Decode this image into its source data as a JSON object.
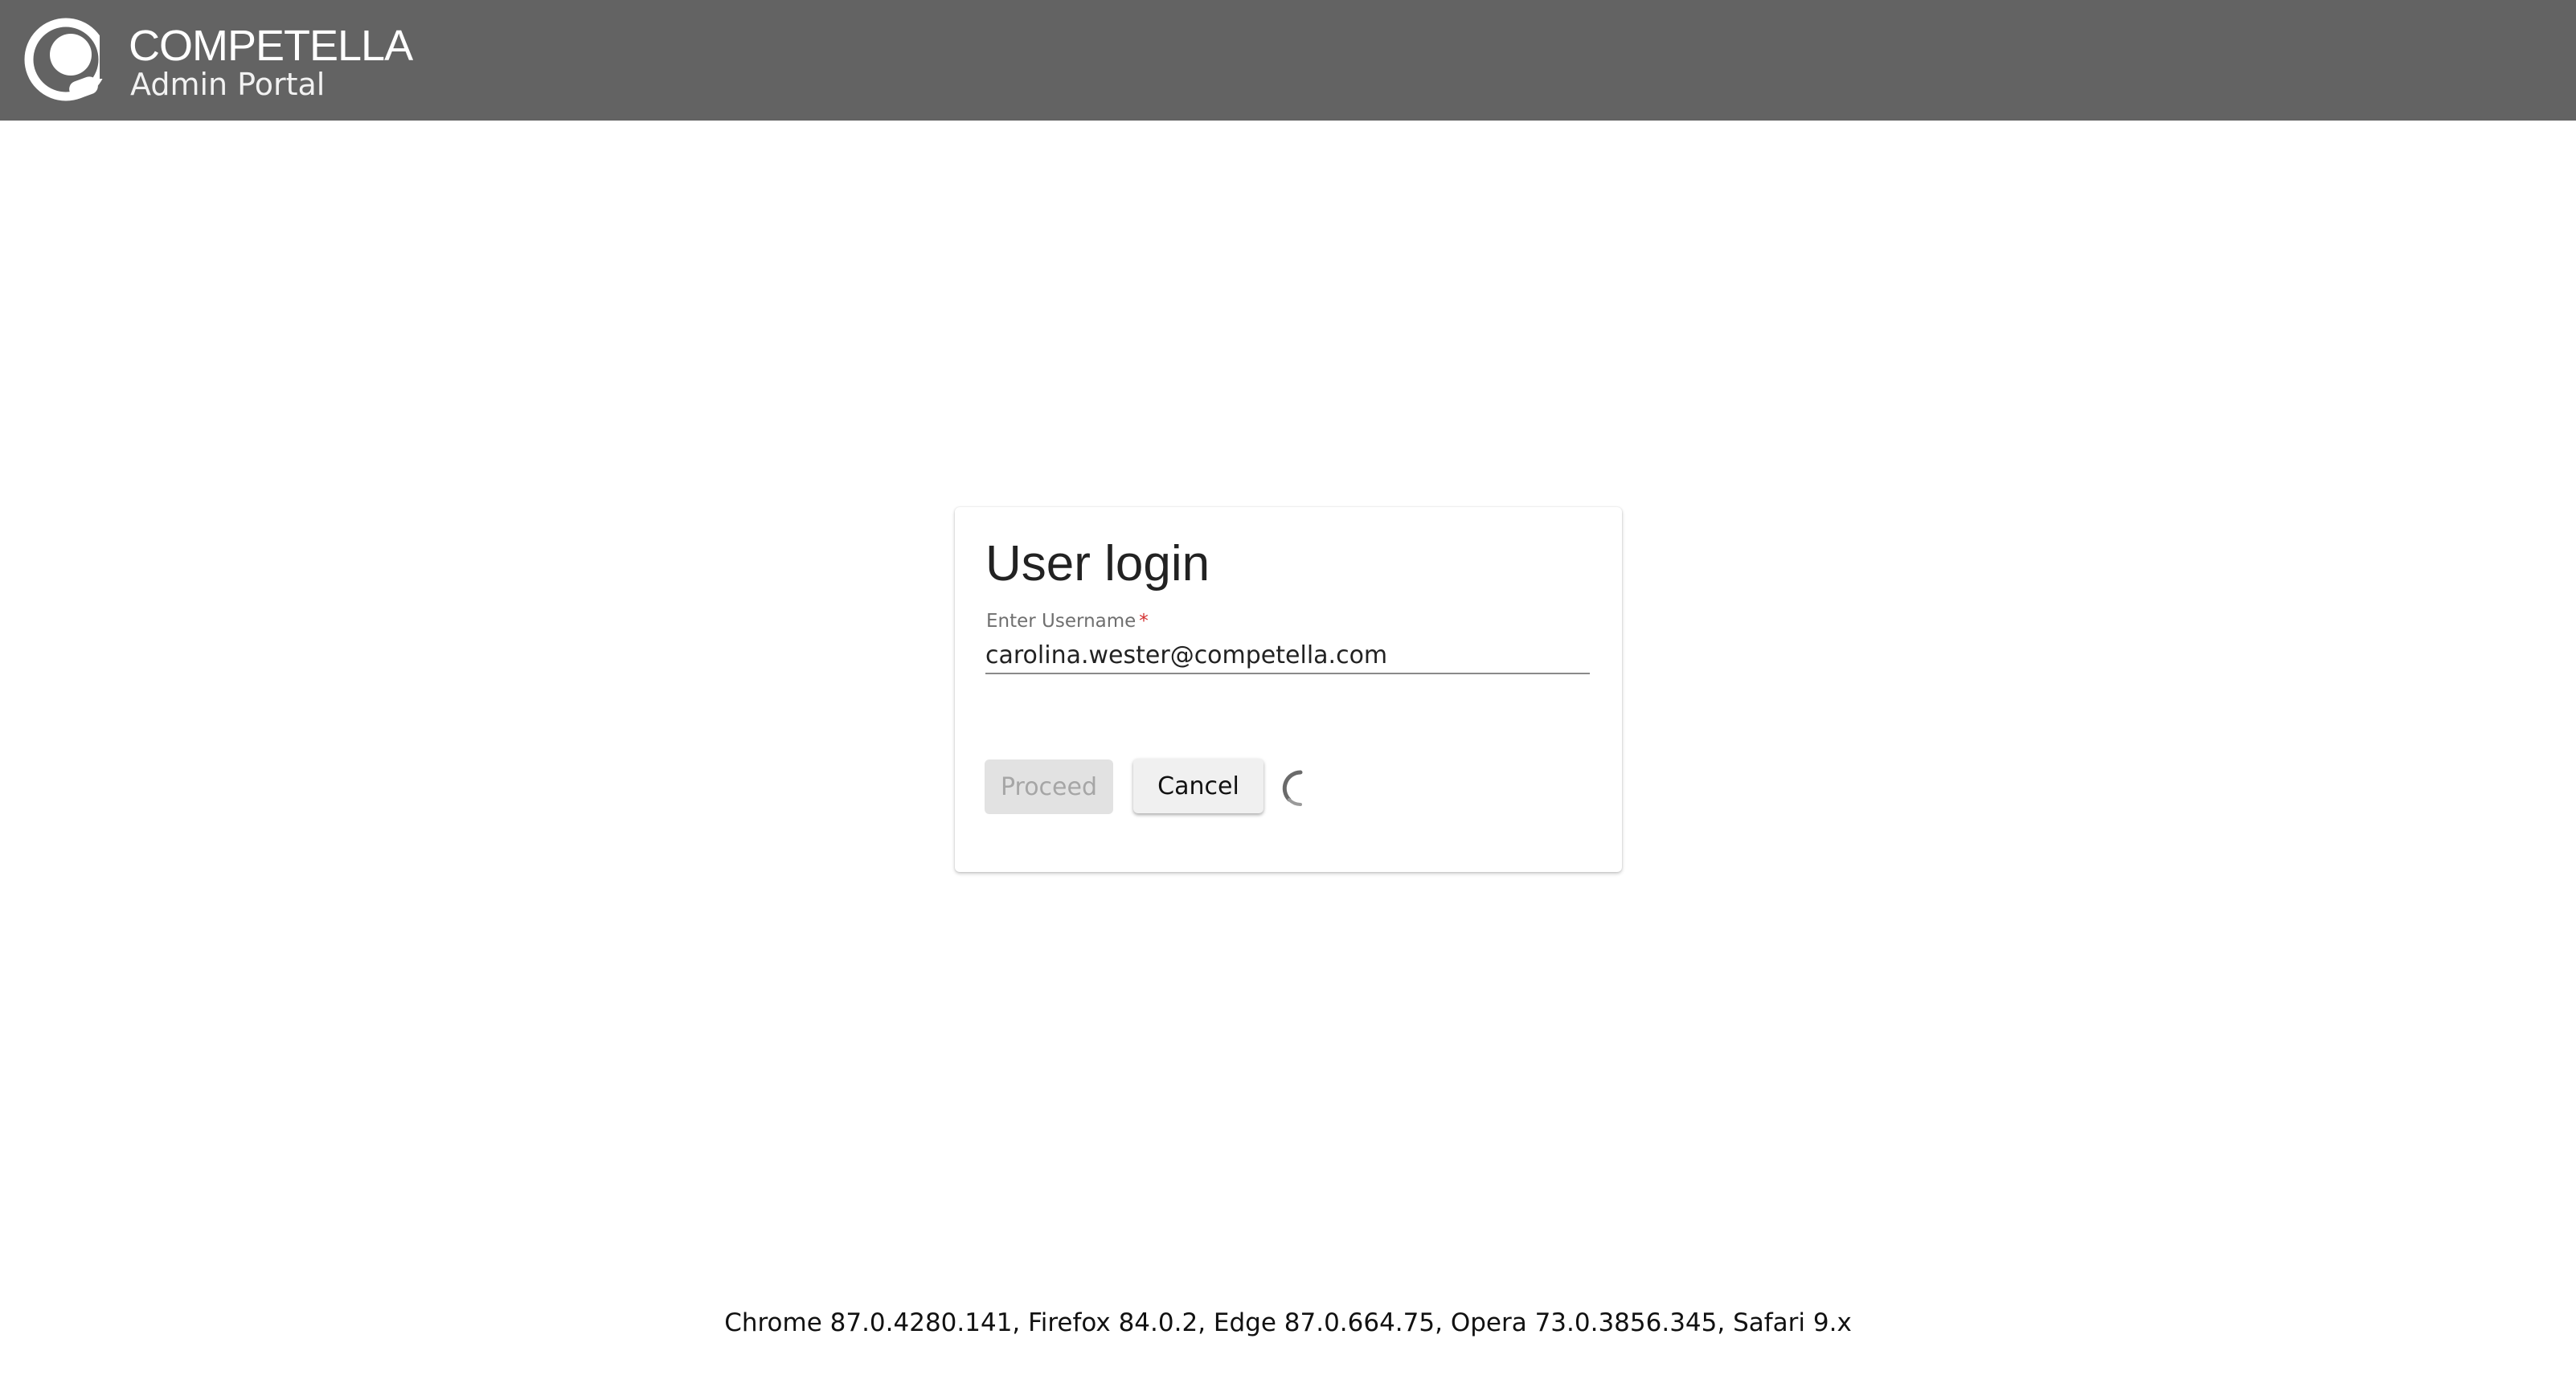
{
  "header": {
    "brand_name": "COMPETELLA",
    "brand_subtitle": "Admin Portal",
    "logo_icon": "competella-logo-icon",
    "background_color": "#636363"
  },
  "login_card": {
    "title": "User login",
    "username_label": "Enter Username",
    "required_marker": "*",
    "username_value": "carolina.wester@competella.com",
    "proceed_label": "Proceed",
    "cancel_label": "Cancel",
    "loading_icon": "spinner-icon"
  },
  "footer": {
    "browser_versions": "Chrome 87.0.4280.141, Firefox 84.0.2, Edge 87.0.664.75, Opera 73.0.3856.345, Safari 9.x"
  }
}
